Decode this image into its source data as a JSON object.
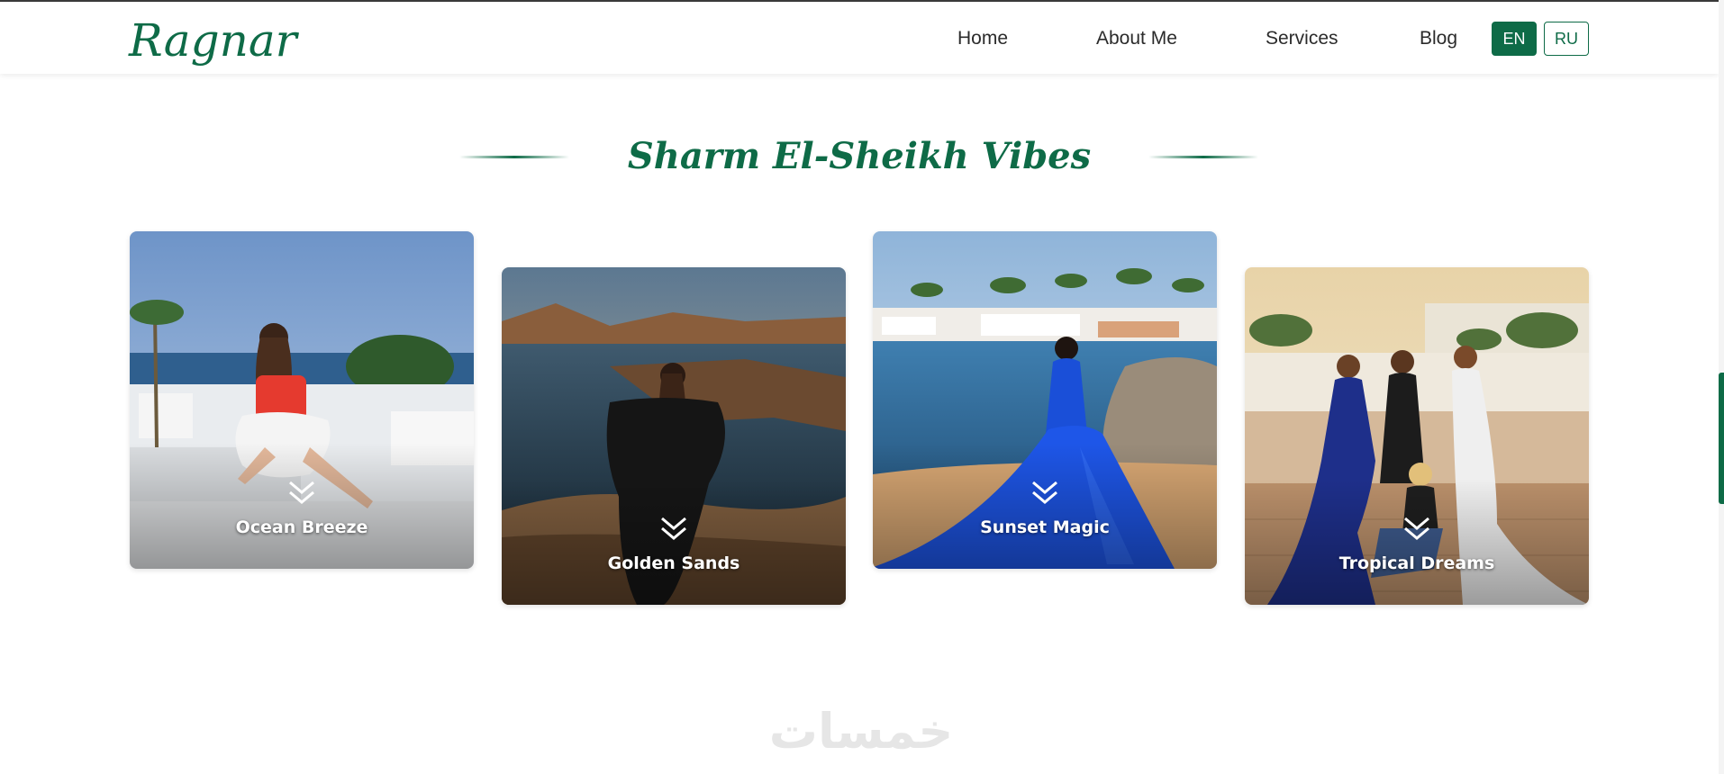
{
  "brand": {
    "logo_text": "Ragnar",
    "accent_color": "#0e6b47"
  },
  "nav": {
    "links": [
      {
        "label": "Home"
      },
      {
        "label": "About Me"
      },
      {
        "label": "Services"
      },
      {
        "label": "Blog"
      }
    ],
    "languages": [
      {
        "label": "EN",
        "active": true
      },
      {
        "label": "RU",
        "active": false
      }
    ]
  },
  "section": {
    "title": "Sharm El-Sheikh Vibes"
  },
  "gallery": {
    "cards": [
      {
        "caption": "Ocean Breeze",
        "icon": "chevron-double-down-icon"
      },
      {
        "caption": "Golden Sands",
        "icon": "chevron-double-down-icon"
      },
      {
        "caption": "Sunset Magic",
        "icon": "chevron-double-down-icon"
      },
      {
        "caption": "Tropical Dreams",
        "icon": "chevron-double-down-icon"
      }
    ]
  },
  "watermark": {
    "text": "خمسات"
  }
}
